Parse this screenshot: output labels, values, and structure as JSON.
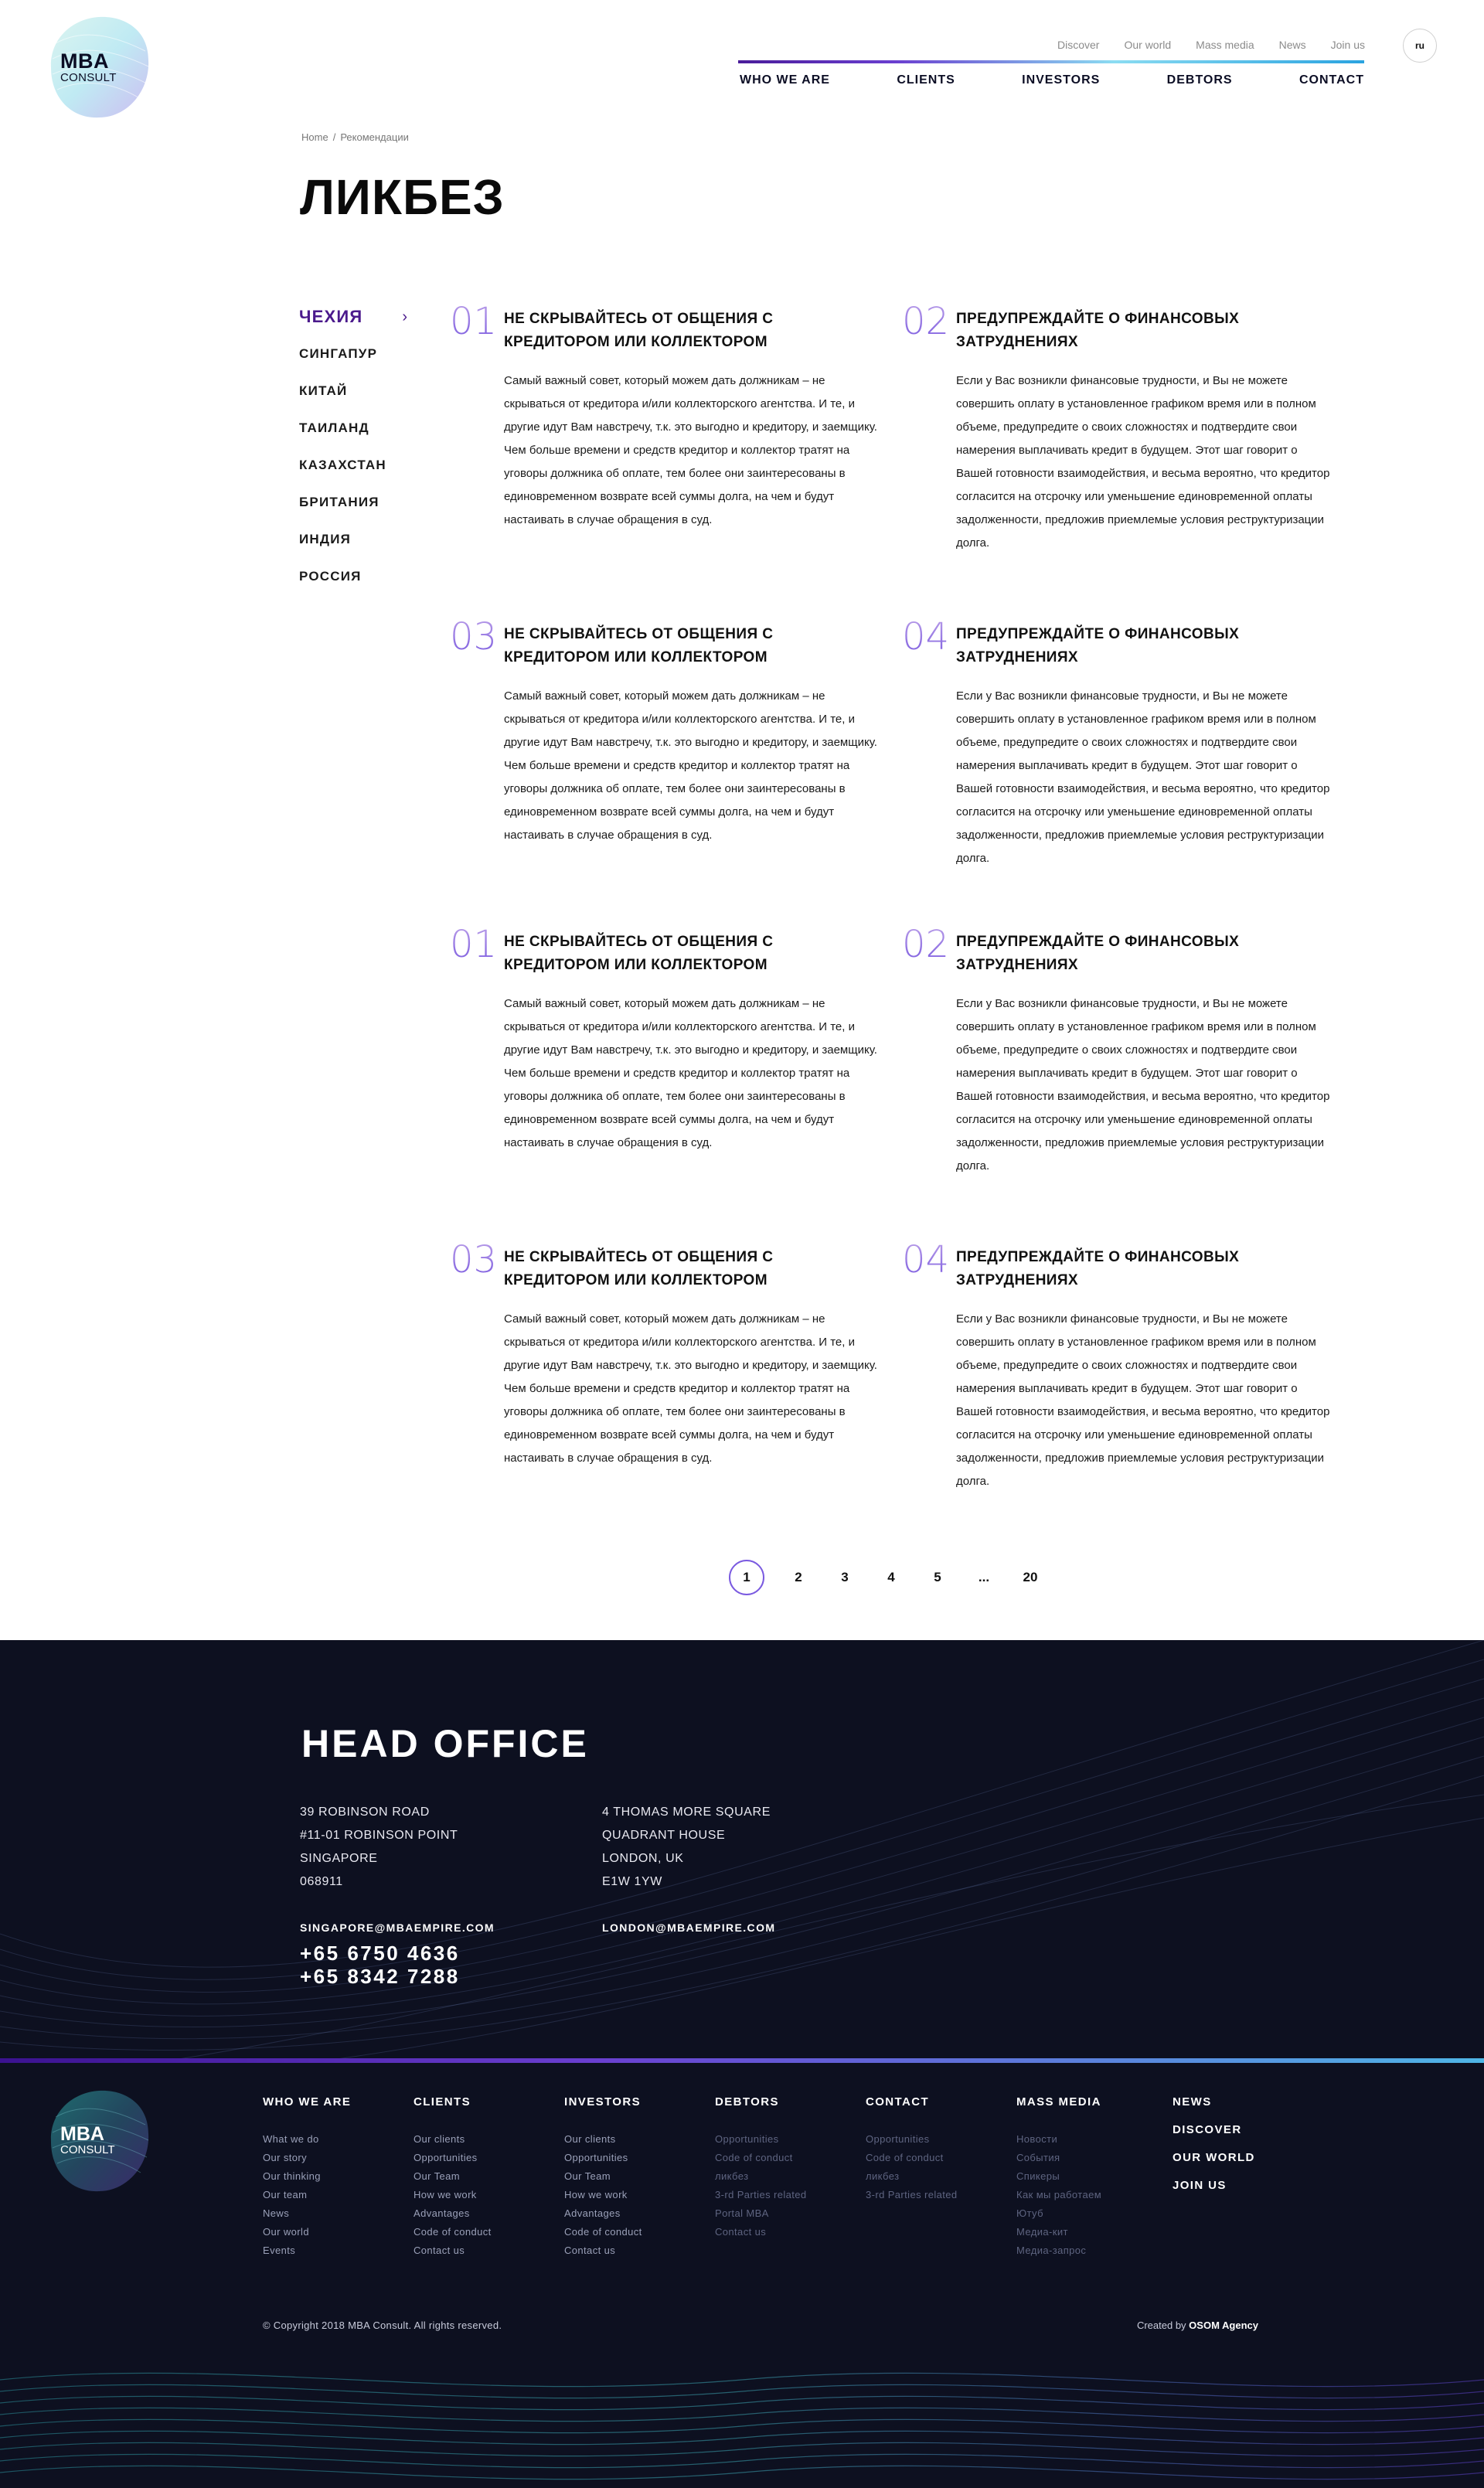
{
  "brand": {
    "logo_line1": "MBA",
    "logo_line2": "CONSULT"
  },
  "topnav": [
    "Discover",
    "Our world",
    "Mass media",
    "News",
    "Join us"
  ],
  "lang": "ru",
  "mainnav": [
    "WHO WE ARE",
    "CLIENTS",
    "INVESTORS",
    "DEBTORS",
    "CONTACT"
  ],
  "breadcrumb": {
    "home": "Home",
    "sep": "/",
    "current": "Рекомендации"
  },
  "page_title": "ЛИКБЕЗ",
  "sidebar": [
    "ЧЕХИЯ",
    "СИНГАПУР",
    "КИТАЙ",
    "ТАИЛАНД",
    "КАЗАХСТАН",
    "БРИТАНИЯ",
    "ИНДИЯ",
    "РОССИЯ"
  ],
  "cards": [
    {
      "num": "01",
      "title": "НЕ СКРЫВАЙТЕСЬ ОТ ОБЩЕНИЯ С КРЕДИТОРОМ ИЛИ КОЛЛЕКТОРОМ",
      "text": "Самый важный совет, который можем дать должникам – не скрываться от кредитора и/или коллекторского агентства. И те, и другие идут Вам навстречу, т.к. это выгодно и кредитору, и заемщику. Чем больше времени и средств кредитор и коллектор тратят на уговоры должника об оплате, тем более они заинтересованы в единовременном возврате всей суммы долга, на чем и будут настаивать в случае обращения в суд."
    },
    {
      "num": "02",
      "title": "ПРЕДУПРЕЖДАЙТЕ О ФИНАНСОВЫХ ЗАТРУДНЕНИЯХ",
      "text": "Если у Вас возникли финансовые трудности, и Вы не можете совершить оплату в установленное графиком время или в полном объеме, предупредите о своих сложностях и подтвердите свои намерения выплачивать кредит в будущем. Этот шаг говорит о Вашей готовности взаимодействия, и весьма вероятно, что кредитор согласится на отсрочку или уменьшение единовременной оплаты задолженности, предложив приемлемые условия реструктуризации долга."
    },
    {
      "num": "03",
      "title": "НЕ СКРЫВАЙТЕСЬ ОТ ОБЩЕНИЯ С КРЕДИТОРОМ ИЛИ КОЛЛЕКТОРОМ",
      "text": "Самый важный совет, который можем дать должникам – не скрываться от кредитора и/или коллекторского агентства. И те, и другие идут Вам навстречу, т.к. это выгодно и кредитору, и заемщику. Чем больше времени и средств кредитор и коллектор тратят на уговоры должника об оплате, тем более они заинтересованы в единовременном возврате всей суммы долга, на чем и будут настаивать в случае обращения в суд."
    },
    {
      "num": "04",
      "title": "ПРЕДУПРЕЖДАЙТЕ О ФИНАНСОВЫХ ЗАТРУДНЕНИЯХ",
      "text": "Если у Вас возникли финансовые трудности, и Вы не можете совершить оплату в установленное графиком время или в полном объеме, предупредите о своих сложностях и подтвердите свои намерения выплачивать кредит в будущем. Этот шаг говорит о Вашей готовности взаимодействия, и весьма вероятно, что кредитор согласится на отсрочку или уменьшение единовременной оплаты задолженности, предложив приемлемые условия реструктуризации долга."
    },
    {
      "num": "01",
      "title": "НЕ СКРЫВАЙТЕСЬ ОТ ОБЩЕНИЯ С КРЕДИТОРОМ ИЛИ КОЛЛЕКТОРОМ",
      "text": "Самый важный совет, который можем дать должникам – не скрываться от кредитора и/или коллекторского агентства. И те, и другие идут Вам навстречу, т.к. это выгодно и кредитору, и заемщику. Чем больше времени и средств кредитор и коллектор тратят на уговоры должника об оплате, тем более они заинтересованы в единовременном возврате всей суммы долга, на чем и будут настаивать в случае обращения в суд."
    },
    {
      "num": "02",
      "title": "ПРЕДУПРЕЖДАЙТЕ О ФИНАНСОВЫХ ЗАТРУДНЕНИЯХ",
      "text": "Если у Вас возникли финансовые трудности, и Вы не можете совершить оплату в установленное графиком время или в полном объеме, предупредите о своих сложностях и подтвердите свои намерения выплачивать кредит в будущем. Этот шаг говорит о Вашей готовности взаимодействия, и весьма вероятно, что кредитор согласится на отсрочку или уменьшение единовременной оплаты задолженности, предложив приемлемые условия реструктуризации долга."
    },
    {
      "num": "03",
      "title": "НЕ СКРЫВАЙТЕСЬ ОТ ОБЩЕНИЯ С КРЕДИТОРОМ ИЛИ КОЛЛЕКТОРОМ",
      "text": "Самый важный совет, который можем дать должникам – не скрываться от кредитора и/или коллекторского агентства. И те, и другие идут Вам навстречу, т.к. это выгодно и кредитору, и заемщику. Чем больше времени и средств кредитор и коллектор тратят на уговоры должника об оплате, тем более они заинтересованы в единовременном возврате всей суммы долга, на чем и будут настаивать в случае обращения в суд."
    },
    {
      "num": "04",
      "title": "ПРЕДУПРЕЖДАЙТЕ О ФИНАНСОВЫХ ЗАТРУДНЕНИЯХ",
      "text": "Если у Вас возникли финансовые трудности, и Вы не можете совершить оплату в установленное графиком время или в полном объеме, предупредите о своих сложностях и подтвердите свои намерения выплачивать кредит в будущем. Этот шаг говорит о Вашей готовности взаимодействия, и весьма вероятно, что кредитор согласится на отсрочку или уменьшение единовременной оплаты задолженности, предложив приемлемые условия реструктуризации долга."
    }
  ],
  "pager": [
    "1",
    "2",
    "3",
    "4",
    "5",
    "...",
    "20"
  ],
  "office": {
    "title": "HEAD OFFICE",
    "sg_address": [
      "39 ROBINSON ROAD",
      "#11-01 ROBINSON POINT",
      "SINGAPORE",
      "068911"
    ],
    "uk_address": [
      "4 THOMAS MORE SQUARE",
      "QUADRANT HOUSE",
      "LONDON, UK",
      "E1W 1YW"
    ],
    "sg_email": "SINGAPORE@MBAEMPIRE.COM",
    "uk_email": "LONDON@MBAEMPIRE.COM",
    "phone1": "+65 6750 4636",
    "phone2": "+65 8342 7288"
  },
  "footer": {
    "columns": [
      {
        "title": "WHO WE ARE",
        "items": [
          "What we do",
          "Our story",
          "Our thinking",
          "Our team",
          "News",
          "Our world",
          "Events"
        ]
      },
      {
        "title": "CLIENTS",
        "items": [
          "Our clients",
          "Opportunities",
          "Our Team",
          "How we work",
          "Advantages",
          "Code of conduct",
          "Contact us"
        ]
      },
      {
        "title": "INVESTORS",
        "items": [
          "Our clients",
          "Opportunities",
          "Our Team",
          "How we work",
          "Advantages",
          "Code of conduct",
          "Contact us"
        ]
      },
      {
        "title": "DEBTORS",
        "items": [
          "Opportunities",
          "Code of conduct",
          "ликбез",
          "3-rd Parties related",
          "Portal MBA",
          "Contact us"
        ]
      },
      {
        "title": "CONTACT",
        "items": [
          "Opportunities",
          "Code of conduct",
          "ликбез",
          "3-rd Parties related"
        ]
      },
      {
        "title": "MASS MEDIA",
        "items": [
          "Новости",
          "События",
          "Спикеры",
          "Как мы работаем",
          "Ютуб",
          "Медиа-кит",
          "Медиа-запрос"
        ]
      }
    ],
    "extra": [
      "NEWS",
      "DISCOVER",
      "OUR WORLD",
      "JOIN US"
    ],
    "copyright": "© Copyright 2018 MBA Consult. All rights reserved.",
    "created_label": "Created by",
    "created_by": "OSOM Agency"
  }
}
